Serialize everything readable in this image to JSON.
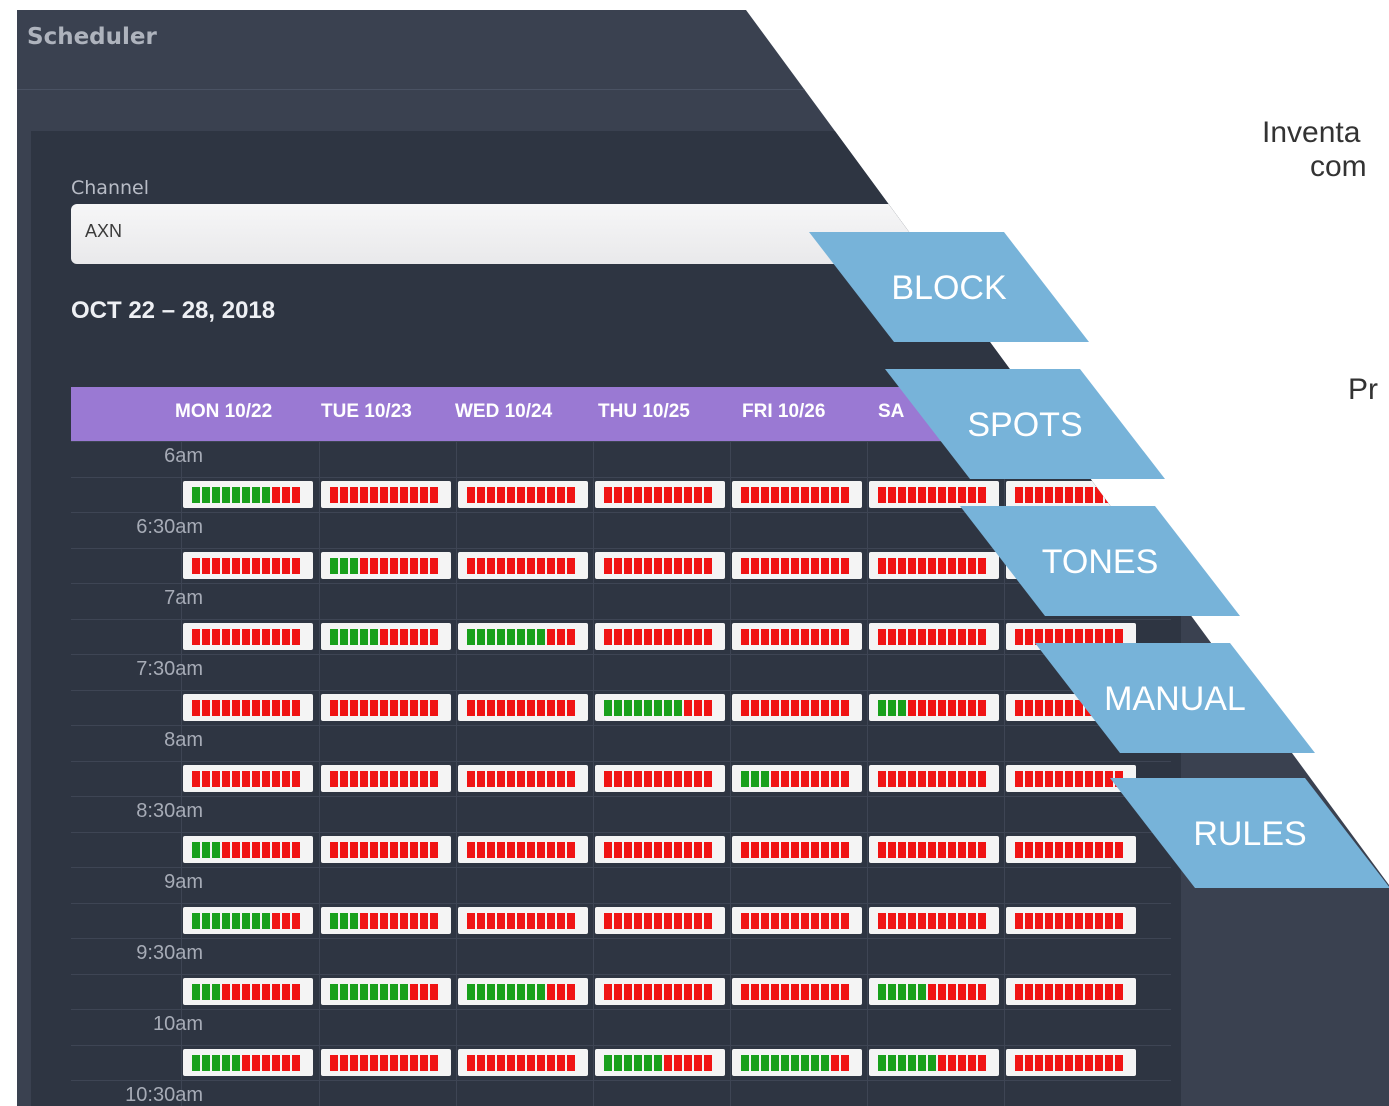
{
  "app": {
    "title": "Scheduler",
    "channel_label": "Channel",
    "channel_value": "AXN",
    "week_title": "OCT 22 – 28, 2018"
  },
  "schedule": {
    "days": [
      "MON 10/22",
      "TUE 10/23",
      "WED 10/24",
      "THU 10/25",
      "FRI 10/26",
      "SA"
    ],
    "times": [
      "6am",
      "6:30am",
      "7am",
      "7:30am",
      "8am",
      "8:30am",
      "9am",
      "9:30am",
      "10am",
      "10:30am"
    ],
    "slots_per_bar": 11,
    "rows": [
      [
        8,
        0,
        0,
        0,
        0,
        0,
        0
      ],
      [
        0,
        3,
        0,
        0,
        0,
        0,
        0
      ],
      [
        0,
        5,
        8,
        0,
        0,
        0,
        0
      ],
      [
        0,
        0,
        0,
        8,
        0,
        3,
        0
      ],
      [
        0,
        0,
        0,
        0,
        3,
        0,
        0
      ],
      [
        3,
        0,
        0,
        0,
        0,
        0,
        0
      ],
      [
        8,
        3,
        0,
        0,
        0,
        0,
        0
      ],
      [
        3,
        8,
        8,
        0,
        0,
        5,
        0
      ],
      [
        5,
        0,
        0,
        6,
        9,
        6,
        0
      ]
    ]
  },
  "colors": {
    "available": "#19a01c",
    "booked": "#f01414",
    "header": "#9a79d3",
    "tag": "#77b3d9"
  },
  "tags": [
    "BLOCK",
    "SPOTS",
    "TONES",
    "MANUAL",
    "RULES"
  ],
  "right_text": {
    "line1": "Inventa",
    "line2": "com",
    "line3": "Pr"
  }
}
